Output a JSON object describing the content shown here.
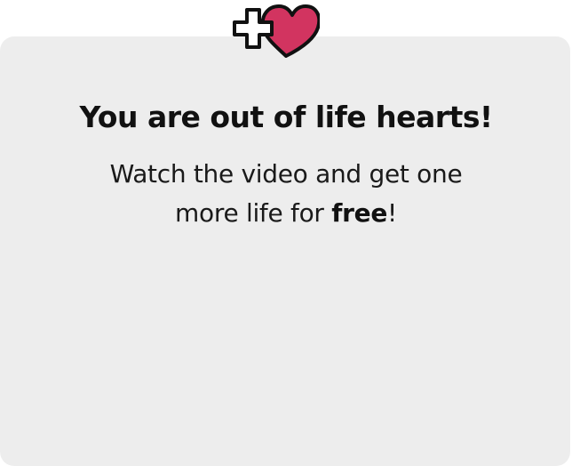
{
  "dialog": {
    "icon": "plus-heart-icon",
    "title": "You are out of life hearts!",
    "message_line1": "Watch the video and get one",
    "message_line2_before": "more life for ",
    "message_line2_bold": "free",
    "message_line2_after": "!"
  },
  "colors": {
    "panel_background": "#ededed",
    "heart_fill": "#d23460",
    "text": "#111111"
  }
}
